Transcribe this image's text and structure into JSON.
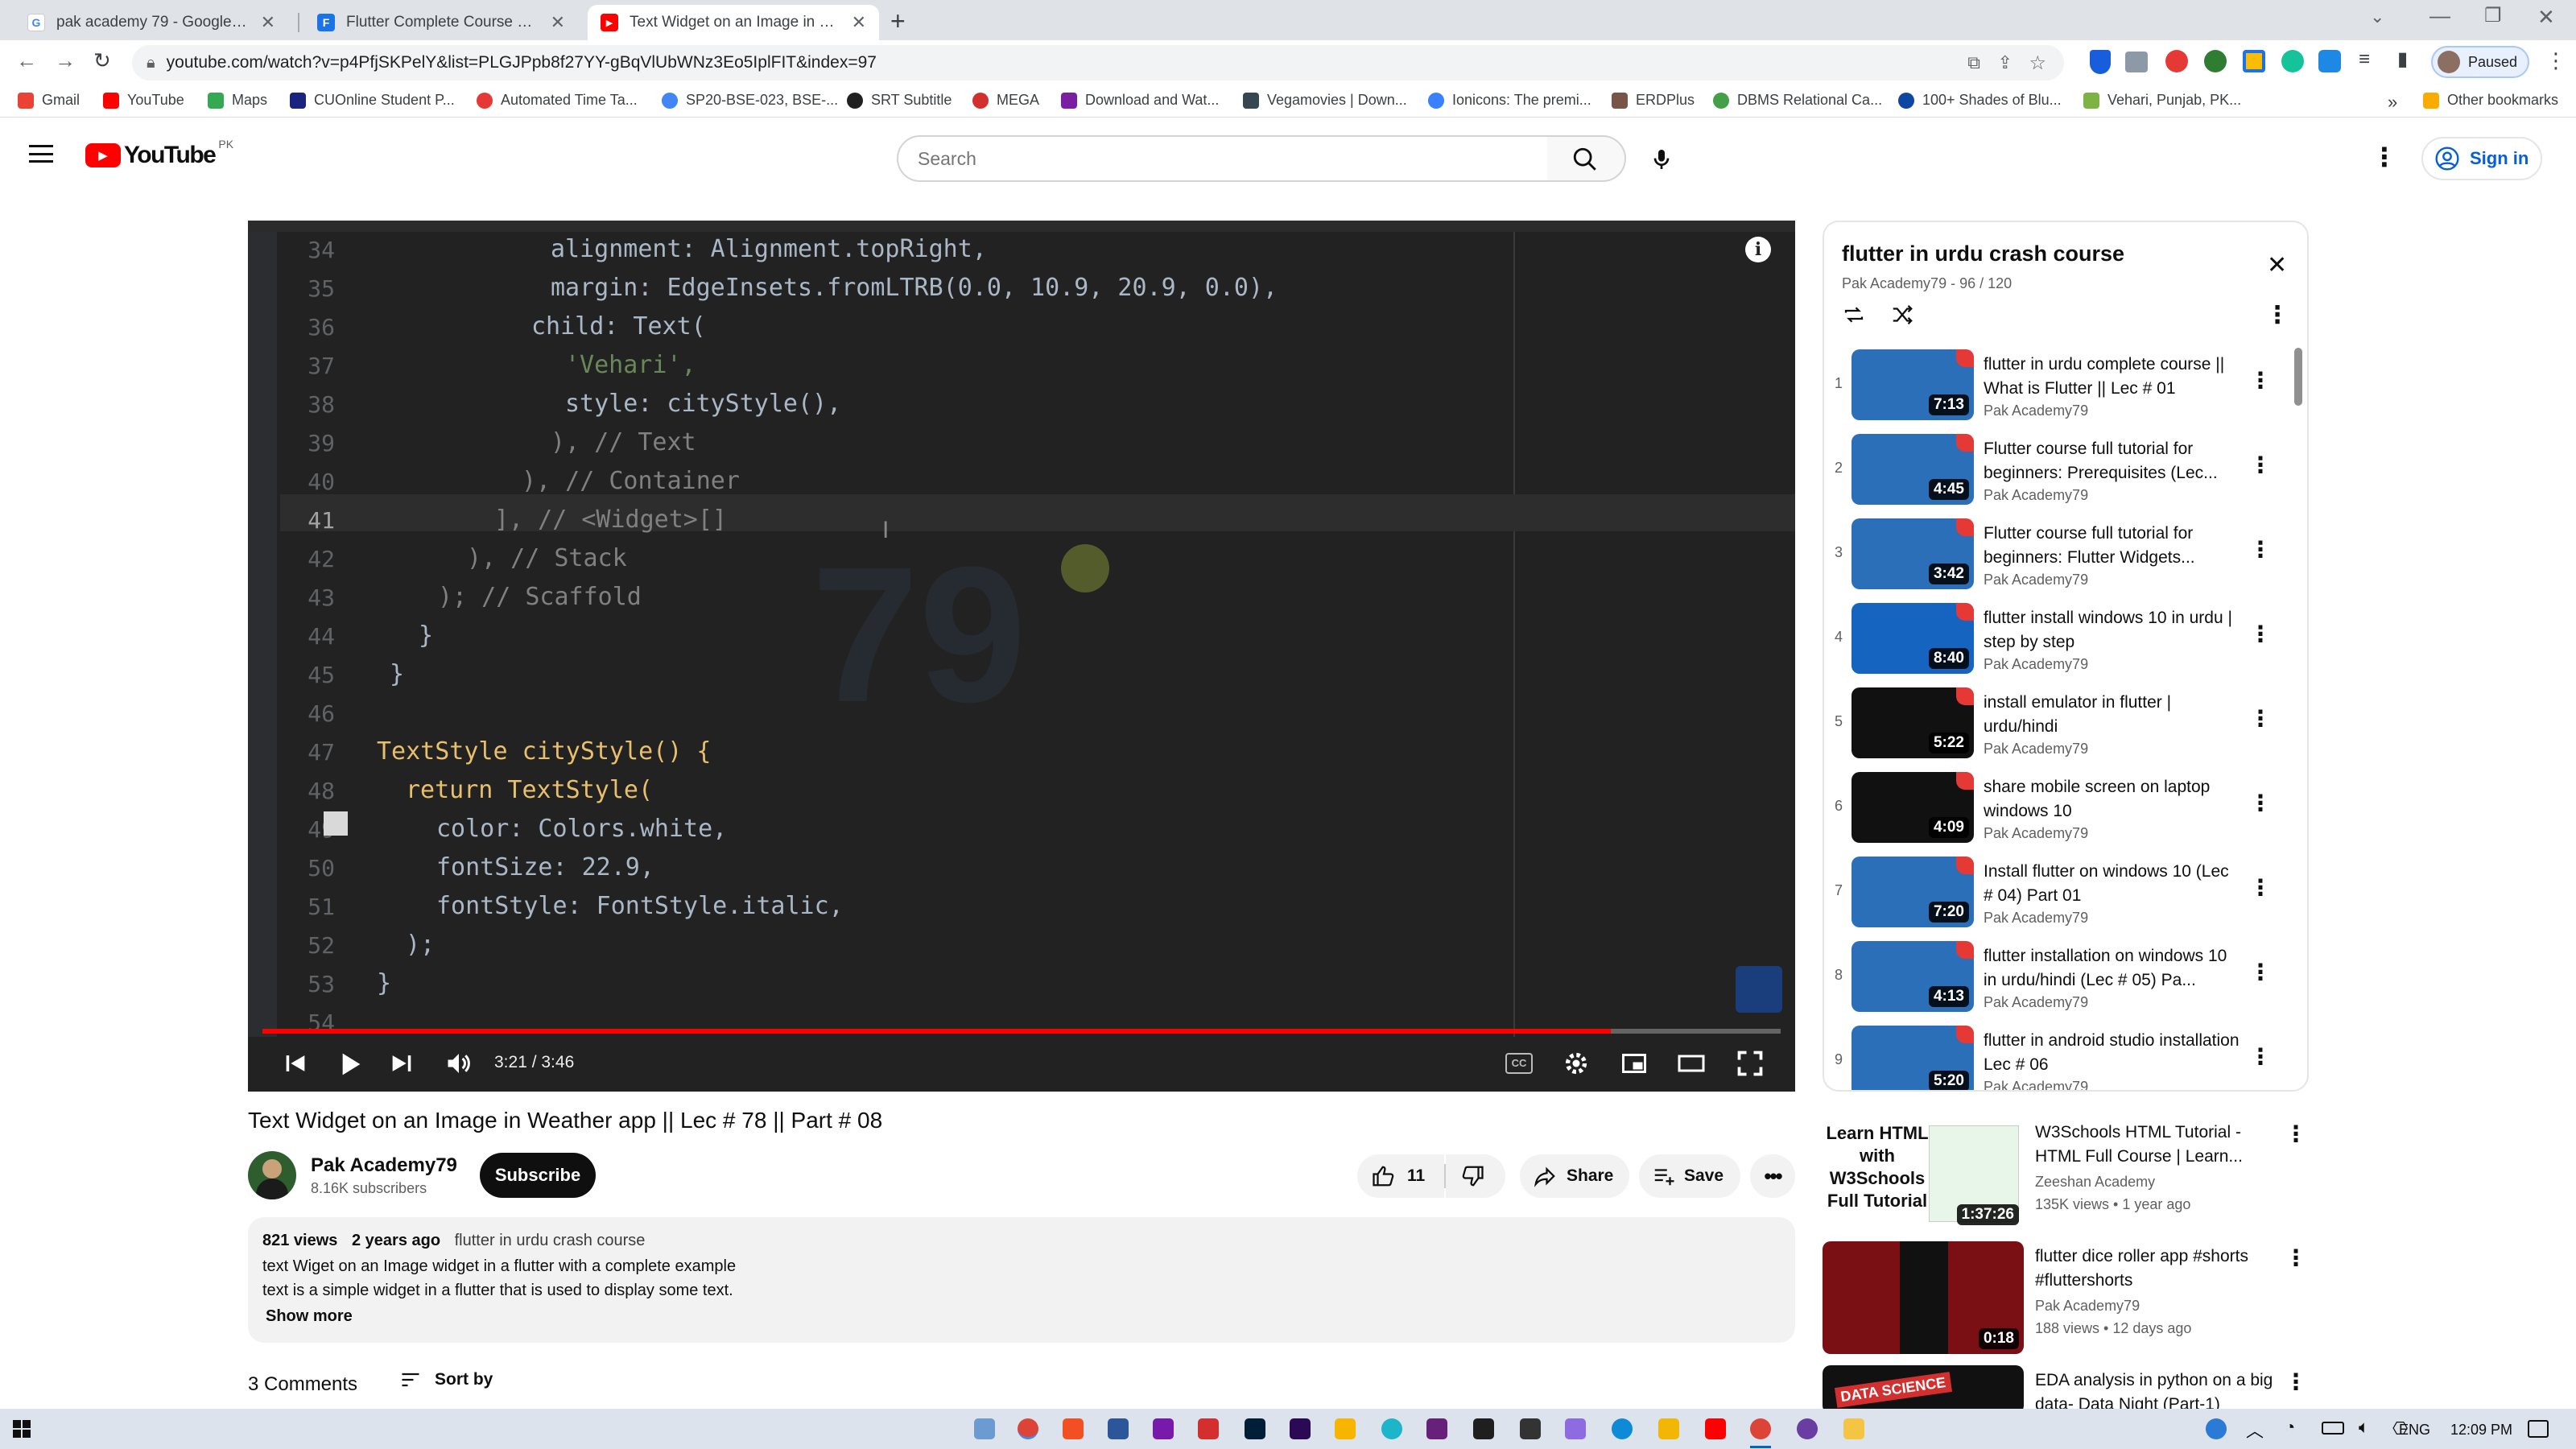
{
  "tabs": [
    {
      "title": "pak academy 79 - Google Search",
      "fav": "G",
      "color": "#4285f4"
    },
    {
      "title": "Flutter Complete Course 2023",
      "fav": "F",
      "color": "#1a73e8"
    },
    {
      "title": "Text Widget on an Image in Weat",
      "fav": "▶",
      "color": "#ff0000"
    }
  ],
  "address": {
    "url": "youtube.com/watch?v=p4PfjSKPelY&list=PLGJPpb8f27YY-gBqVlUbWNz3Eo5IplFIT&index=97"
  },
  "profile": {
    "label": "Paused"
  },
  "bookmarks": [
    {
      "label": "Gmail",
      "color": "#ea4335"
    },
    {
      "label": "YouTube",
      "color": "#ff0000"
    },
    {
      "label": "Maps",
      "color": "#34a853"
    },
    {
      "label": "CUOnline Student P...",
      "color": "#1a237e"
    },
    {
      "label": "Automated Time Ta...",
      "color": "#e53935"
    },
    {
      "label": "SP20-BSE-023, BSE-...",
      "color": "#4285f4"
    },
    {
      "label": "SRT Subtitle",
      "color": "#212121"
    },
    {
      "label": "MEGA",
      "color": "#d32f2f"
    },
    {
      "label": "Download and Wat...",
      "color": "#7b1fa2"
    },
    {
      "label": "Vegamovies | Down...",
      "color": "#37474f"
    },
    {
      "label": "Ionicons: The premi...",
      "color": "#3880ff"
    },
    {
      "label": "ERDPlus",
      "color": "#795548"
    },
    {
      "label": "DBMS Relational Ca...",
      "color": "#43a047"
    },
    {
      "label": "100+ Shades of Blu...",
      "color": "#0d47a1"
    },
    {
      "label": "Vehari, Punjab, PK...",
      "color": "#7cb342"
    }
  ],
  "other_bookmarks": "Other bookmarks",
  "youtube": {
    "logo": "YouTube",
    "region": "PK",
    "search_placeholder": "Search",
    "signin": "Sign in"
  },
  "code_lines": [
    {
      "n": "34",
      "text": "alignment: Alignment.topRight,"
    },
    {
      "n": "35",
      "text": "margin: EdgeInsets.fromLTRB(0.0, 10.9, 20.9, 0.0),"
    },
    {
      "n": "36",
      "text": "child: Text("
    },
    {
      "n": "37",
      "text": "'Vehari',"
    },
    {
      "n": "38",
      "text": "style: cityStyle(),"
    },
    {
      "n": "39",
      "text": "), // Text"
    },
    {
      "n": "40",
      "text": "), // Container"
    },
    {
      "n": "41",
      "text": "], // <Widget>[]"
    },
    {
      "n": "42",
      "text": "), // Stack"
    },
    {
      "n": "43",
      "text": "); // Scaffold"
    },
    {
      "n": "44",
      "text": "}"
    },
    {
      "n": "45",
      "text": "}"
    },
    {
      "n": "46",
      "text": ""
    },
    {
      "n": "47",
      "text": "TextStyle cityStyle() {"
    },
    {
      "n": "48",
      "text": "return TextStyle("
    },
    {
      "n": "49",
      "text": "color: Colors.white,"
    },
    {
      "n": "50",
      "text": "fontSize: 22.9,"
    },
    {
      "n": "51",
      "text": "fontStyle: FontStyle.italic,"
    },
    {
      "n": "52",
      "text": ");"
    },
    {
      "n": "53",
      "text": "}"
    },
    {
      "n": "54",
      "text": ""
    }
  ],
  "player": {
    "time": "3:21 / 3:46",
    "progress": 0.888
  },
  "video": {
    "title": "Text Widget on an Image in Weather app || Lec # 78 || Part # 08",
    "channel": "Pak Academy79",
    "subscribers": "8.16K subscribers",
    "subscribe": "Subscribe",
    "likes": "11",
    "share": "Share",
    "save": "Save",
    "views": "821 views",
    "age": "2 years ago",
    "playlist_link": "flutter in urdu crash course",
    "desc1": "text Wiget on an Image widget in a flutter with a complete example",
    "desc2": "text is a simple widget in a flutter that is used to display some text.",
    "show_more": "Show more",
    "comments": "3 Comments",
    "sort_by": "Sort by"
  },
  "playlist": {
    "title": "flutter in urdu crash course",
    "meta": "Pak Academy79 - 96 / 120",
    "items": [
      {
        "n": "1",
        "title": "flutter in urdu complete course || What is Flutter || Lec # 01",
        "channel": "Pak Academy79",
        "dur": "7:13",
        "bg": "#2a6fb8"
      },
      {
        "n": "2",
        "title": "Flutter course full tutorial for beginners: Prerequisites (Lec...",
        "channel": "Pak Academy79",
        "dur": "4:45",
        "bg": "#2a6fb8"
      },
      {
        "n": "3",
        "title": "Flutter course full tutorial for beginners: Flutter Widgets...",
        "channel": "Pak Academy79",
        "dur": "3:42",
        "bg": "#2a6fb8"
      },
      {
        "n": "4",
        "title": "flutter install windows 10 in urdu | step by step",
        "channel": "Pak Academy79",
        "dur": "8:40",
        "bg": "#1565c0"
      },
      {
        "n": "5",
        "title": "install emulator in flutter | urdu/hindi",
        "channel": "Pak Academy79",
        "dur": "5:22",
        "bg": "#111111"
      },
      {
        "n": "6",
        "title": "share mobile screen on laptop windows 10",
        "channel": "Pak Academy79",
        "dur": "4:09",
        "bg": "#111111"
      },
      {
        "n": "7",
        "title": "Install flutter on windows 10 (Lec # 04) Part 01",
        "channel": "Pak Academy79",
        "dur": "7:20",
        "bg": "#2a6fb8"
      },
      {
        "n": "8",
        "title": "flutter installation on windows 10 in urdu/hindi (Lec # 05) Pa...",
        "channel": "Pak Academy79",
        "dur": "4:13",
        "bg": "#2a6fb8"
      },
      {
        "n": "9",
        "title": "flutter in android studio installation Lec # 06",
        "channel": "Pak Academy79",
        "dur": "5:20",
        "bg": "#2a6fb8"
      }
    ]
  },
  "related": [
    {
      "title": "W3Schools HTML Tutorial - HTML Full Course | Learn...",
      "channel": "Zeeshan Academy",
      "meta": "135K views • 1 year ago",
      "dur": "1:37:26",
      "bg": "#ffffff"
    },
    {
      "title": "flutter dice roller app #shorts #fluttershorts",
      "channel": "Pak Academy79",
      "meta": "188 views • 12 days ago",
      "dur": "0:18",
      "bg": "#7a0f14"
    },
    {
      "title": "EDA analysis in python on a big data- Data Night (Part-1)",
      "channel": "",
      "meta": "",
      "dur": "",
      "bg": "#111111"
    }
  ],
  "thumb_text": {
    "html_learn": "Learn HTML with W3Schools Full Tutorial",
    "data_science": "DATA SCIENCE"
  },
  "taskbar": {
    "lang": "ENG",
    "time": "12:09 PM"
  }
}
